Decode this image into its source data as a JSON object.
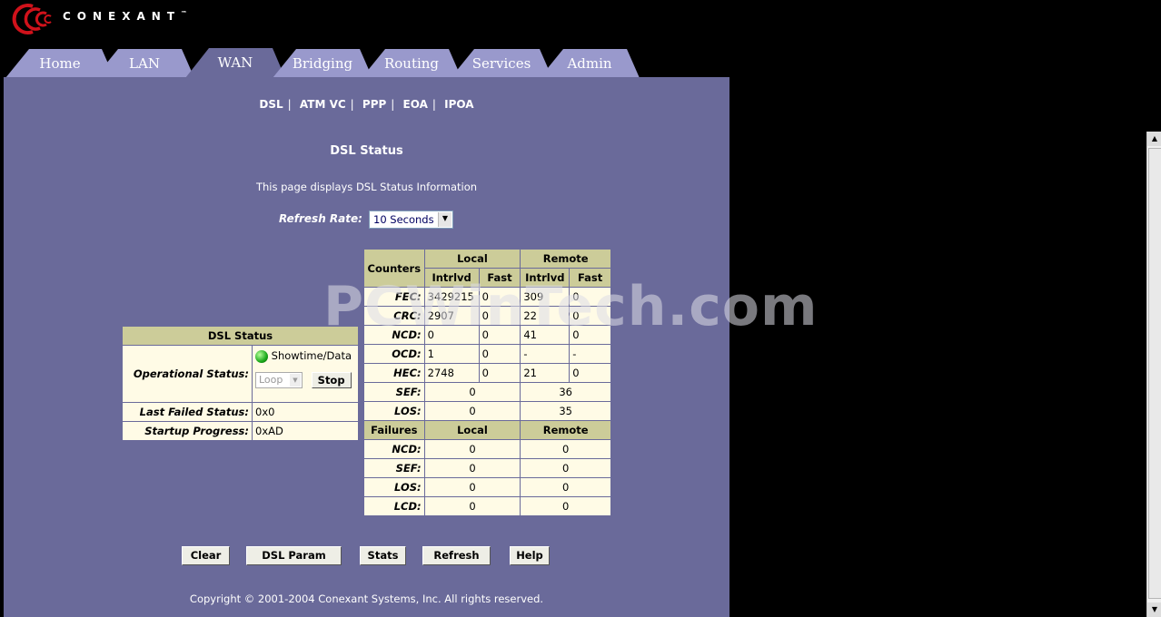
{
  "brand": {
    "name": "CONEXANT",
    "trademark": "™"
  },
  "tabs": [
    {
      "label": "Home"
    },
    {
      "label": "LAN"
    },
    {
      "label": "WAN"
    },
    {
      "label": "Bridging"
    },
    {
      "label": "Routing"
    },
    {
      "label": "Services"
    },
    {
      "label": "Admin"
    }
  ],
  "subnav": [
    "DSL",
    "ATM VC",
    "PPP",
    "EOA",
    "IPOA"
  ],
  "page": {
    "title": "DSL Status",
    "description": "This page displays DSL Status Information",
    "refresh_label": "Refresh Rate:",
    "refresh_value": "10 Seconds"
  },
  "status_table": {
    "header": "DSL Status",
    "operational_label": "Operational Status:",
    "operational_value": "Showtime/Data",
    "loop_select": "Loop",
    "stop_button": "Stop",
    "last_failed_label": "Last Failed Status:",
    "last_failed_value": "0x0",
    "startup_label": "Startup Progress:",
    "startup_value": "0xAD"
  },
  "counters": {
    "header": "Counters",
    "local": "Local",
    "remote": "Remote",
    "interleaved": "Intrlvd",
    "fast": "Fast",
    "rows": [
      {
        "label": "FEC:",
        "values": [
          "3429215",
          "0",
          "309",
          "0"
        ]
      },
      {
        "label": "CRC:",
        "values": [
          "2907",
          "0",
          "22",
          "0"
        ]
      },
      {
        "label": "NCD:",
        "values": [
          "0",
          "0",
          "41",
          "0"
        ]
      },
      {
        "label": "OCD:",
        "values": [
          "1",
          "0",
          "-",
          "-"
        ]
      },
      {
        "label": "HEC:",
        "values": [
          "2748",
          "0",
          "21",
          "0"
        ]
      }
    ],
    "merged_rows": [
      {
        "label": "SEF:",
        "values": [
          "0",
          "36"
        ]
      },
      {
        "label": "LOS:",
        "values": [
          "0",
          "35"
        ]
      }
    ]
  },
  "failures": {
    "header": "Failures",
    "local": "Local",
    "remote": "Remote",
    "rows": [
      {
        "label": "NCD:",
        "values": [
          "0",
          "0"
        ]
      },
      {
        "label": "SEF:",
        "values": [
          "0",
          "0"
        ]
      },
      {
        "label": "LOS:",
        "values": [
          "0",
          "0"
        ]
      },
      {
        "label": "LCD:",
        "values": [
          "0",
          "0"
        ]
      }
    ]
  },
  "buttons": {
    "clear": "Clear",
    "dsl_param": "DSL Param",
    "stats": "Stats",
    "refresh": "Refresh",
    "help": "Help"
  },
  "copyright": "Copyright © 2001-2004 Conexant Systems, Inc. All rights reserved.",
  "watermark": "PCWinTech.com"
}
